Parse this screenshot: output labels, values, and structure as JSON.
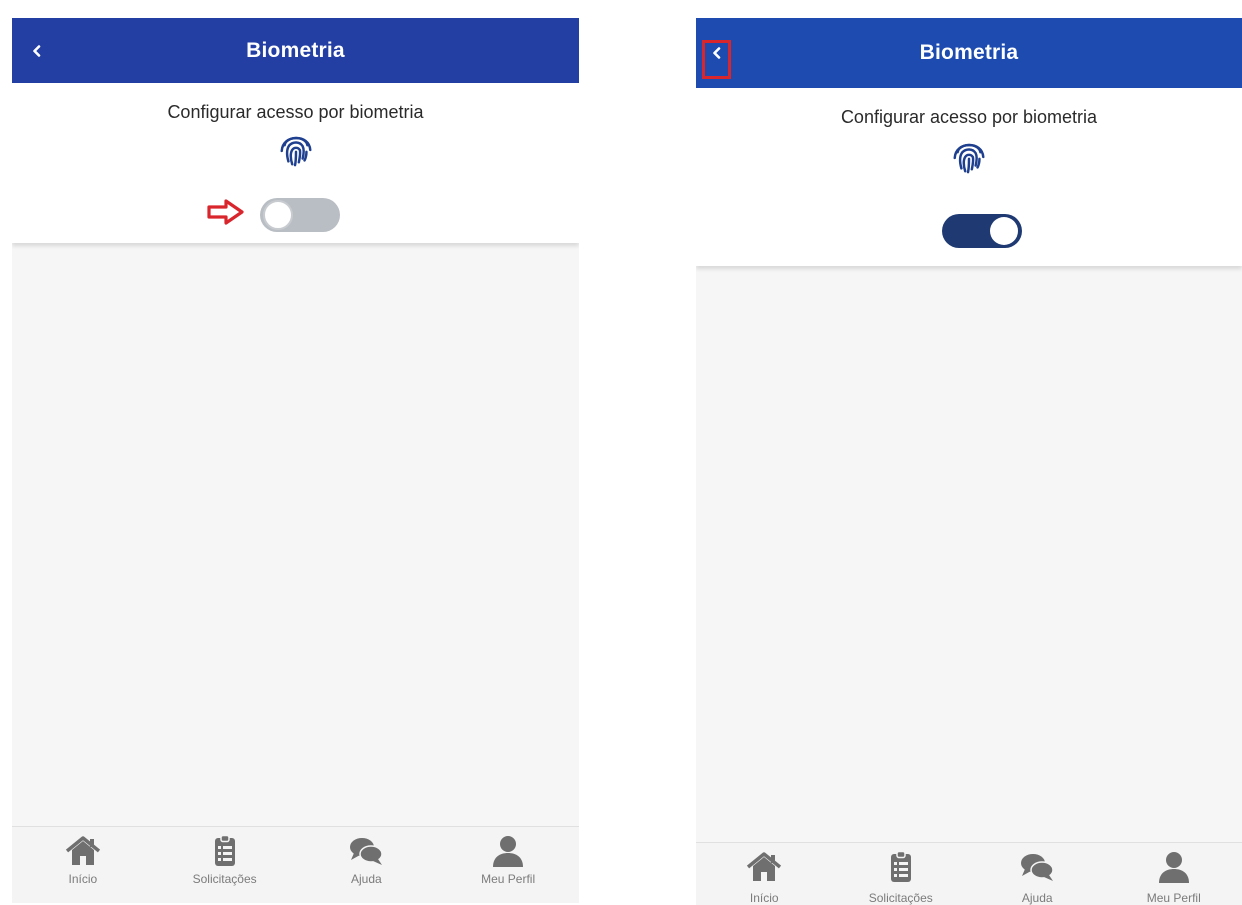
{
  "screens": [
    {
      "header": {
        "title": "Biometria"
      },
      "settings": {
        "title": "Configurar acesso por biometria",
        "biometric_enabled": false
      },
      "nav": [
        {
          "label": "Início",
          "icon": "home-icon"
        },
        {
          "label": "Solicitações",
          "icon": "clipboard-list-icon"
        },
        {
          "label": "Ajuda",
          "icon": "chat-bubbles-icon"
        },
        {
          "label": "Meu Perfil",
          "icon": "user-icon"
        }
      ]
    },
    {
      "header": {
        "title": "Biometria"
      },
      "settings": {
        "title": "Configurar acesso por biometria",
        "biometric_enabled": true
      },
      "nav": [
        {
          "label": "Início",
          "icon": "home-icon"
        },
        {
          "label": "Solicitações",
          "icon": "clipboard-list-icon"
        },
        {
          "label": "Ajuda",
          "icon": "chat-bubbles-icon"
        },
        {
          "label": "Meu Perfil",
          "icon": "user-icon"
        }
      ]
    }
  ],
  "colors": {
    "appbar_left": "#233fa3",
    "appbar_right": "#1d4bb0",
    "fingerprint": "#1f3f8f",
    "toggle_on": "#1f3a72",
    "toggle_off": "#b9bec4",
    "annotation_red": "#d9262d",
    "nav_icon": "#6f6f6f"
  }
}
